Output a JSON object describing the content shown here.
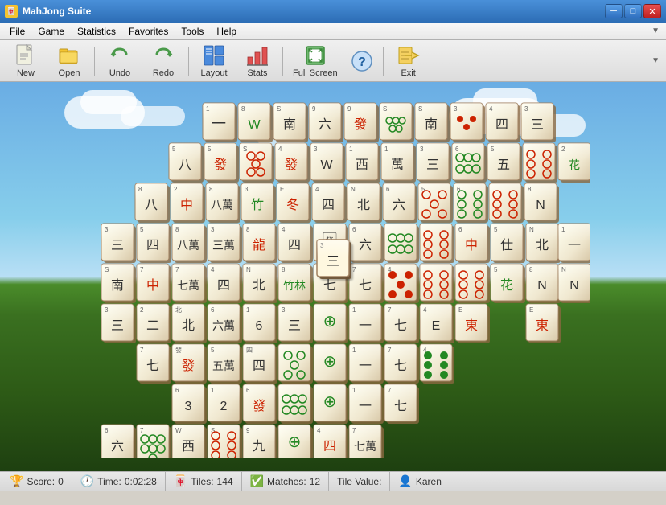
{
  "window": {
    "title": "MahJong Suite",
    "icon": "🀄"
  },
  "titlebar": {
    "minimize_label": "─",
    "maximize_label": "□",
    "close_label": "✕"
  },
  "menubar": {
    "items": [
      {
        "label": "File",
        "id": "file"
      },
      {
        "label": "Game",
        "id": "game"
      },
      {
        "label": "Statistics",
        "id": "statistics"
      },
      {
        "label": "Favorites",
        "id": "favorites"
      },
      {
        "label": "Tools",
        "id": "tools"
      },
      {
        "label": "Help",
        "id": "help"
      }
    ],
    "expand": "▼"
  },
  "toolbar": {
    "buttons": [
      {
        "id": "new",
        "label": "New",
        "icon": "📄"
      },
      {
        "id": "open",
        "label": "Open",
        "icon": "📂"
      },
      {
        "id": "undo",
        "label": "Undo",
        "icon": "↩"
      },
      {
        "id": "redo",
        "label": "Redo",
        "icon": "↪"
      },
      {
        "id": "layout",
        "label": "Layout",
        "icon": "📅"
      },
      {
        "id": "stats",
        "label": "Stats",
        "icon": "📊"
      },
      {
        "id": "fullscreen",
        "label": "Full Screen",
        "icon": "⛶"
      },
      {
        "id": "help",
        "label": "?",
        "icon": "❓"
      },
      {
        "id": "exit",
        "label": "Exit",
        "icon": "🚪"
      }
    ]
  },
  "statusbar": {
    "score_label": "Score:",
    "score_value": "0",
    "time_label": "Time:",
    "time_value": "0:02:28",
    "tiles_label": "Tiles:",
    "tiles_value": "144",
    "matches_label": "Matches:",
    "matches_value": "12",
    "tile_value_label": "Tile Value:",
    "user_label": "Karen"
  },
  "colors": {
    "tile_bg": "#fffff0",
    "tile_border": "#a08060",
    "tile_shadow": "#8a6840",
    "red_char": "#cc2200",
    "green_char": "#228822",
    "sky_top": "#6aade4",
    "grass": "#4a8c2a"
  }
}
